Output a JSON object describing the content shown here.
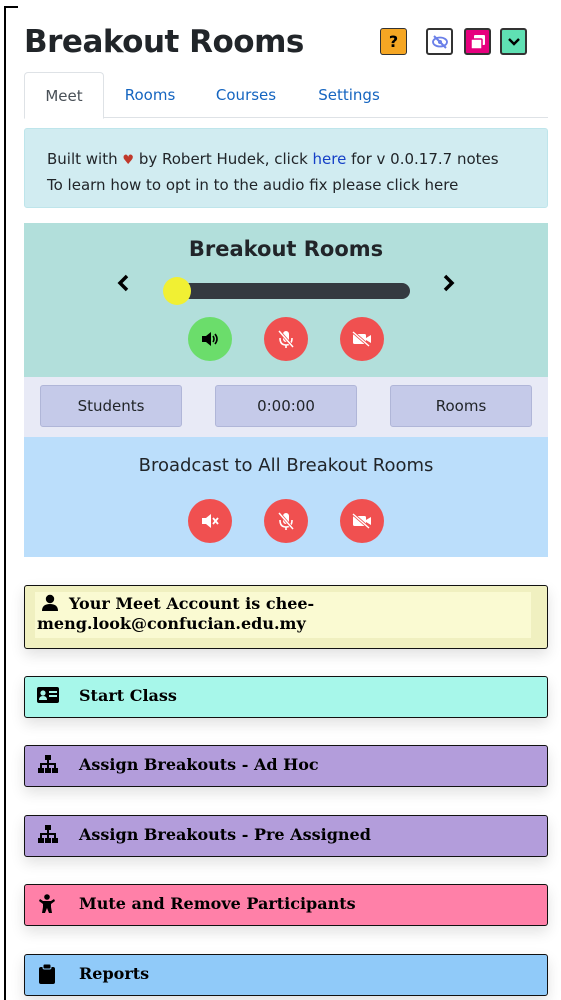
{
  "app": {
    "title": "Breakout Rooms"
  },
  "header_buttons": [
    {
      "name": "help",
      "label": "?"
    }
  ],
  "tabs": [
    {
      "label": "Meet",
      "active": true
    },
    {
      "label": "Rooms",
      "active": false
    },
    {
      "label": "Courses",
      "active": false
    },
    {
      "label": "Settings",
      "active": false
    }
  ],
  "info": {
    "line1_pre": "Built with",
    "line1_heart": "♥",
    "line1_mid": "by Robert Hudek, click",
    "line1_link": "here",
    "line1_post": "for v 0.0.17.7 notes",
    "line2": "To learn how to opt in to the audio fix please click here"
  },
  "breakout_panel": {
    "title": "Breakout Rooms",
    "prev_arrow": "‹",
    "next_arrow": "›",
    "slider_value": 0,
    "buttons": [
      "speaker-on-icon",
      "mic-off-icon",
      "camera-off-icon"
    ]
  },
  "controls": {
    "students_label": "Students",
    "timer_label": "0:00:00",
    "rooms_label": "Rooms"
  },
  "broadcast": {
    "title": "Broadcast to All Breakout Rooms",
    "buttons": [
      "speaker-mute-icon",
      "mic-off-icon",
      "camera-off-icon"
    ]
  },
  "cards": [
    {
      "label": "Your Meet Account is chee-meng.look@confucian.edu.my",
      "icon": "user-icon",
      "color": "#f0f0c0"
    },
    {
      "label": "Start Class",
      "icon": "id-card-icon",
      "color": "#a7f7ea"
    },
    {
      "label": "Assign Breakouts - Ad Hoc",
      "icon": "sitemap-icon",
      "color": "#b39ddb"
    },
    {
      "label": "Assign Breakouts - Pre Assigned",
      "icon": "sitemap-icon",
      "color": "#b39ddb"
    },
    {
      "label": "Mute and Remove Participants",
      "icon": "child-icon",
      "color": "#ff80a8"
    },
    {
      "label": "Reports",
      "icon": "clipboard-icon",
      "color": "#90caf9"
    }
  ],
  "colors": {
    "info_bg": "#d1ecf1",
    "panel_top": "#b2dfdb",
    "panel_mid": "#e8eaf6",
    "panel_broadcast": "#bbdefb",
    "red_button": "#f05050",
    "green_button": "#6bdd6b"
  }
}
